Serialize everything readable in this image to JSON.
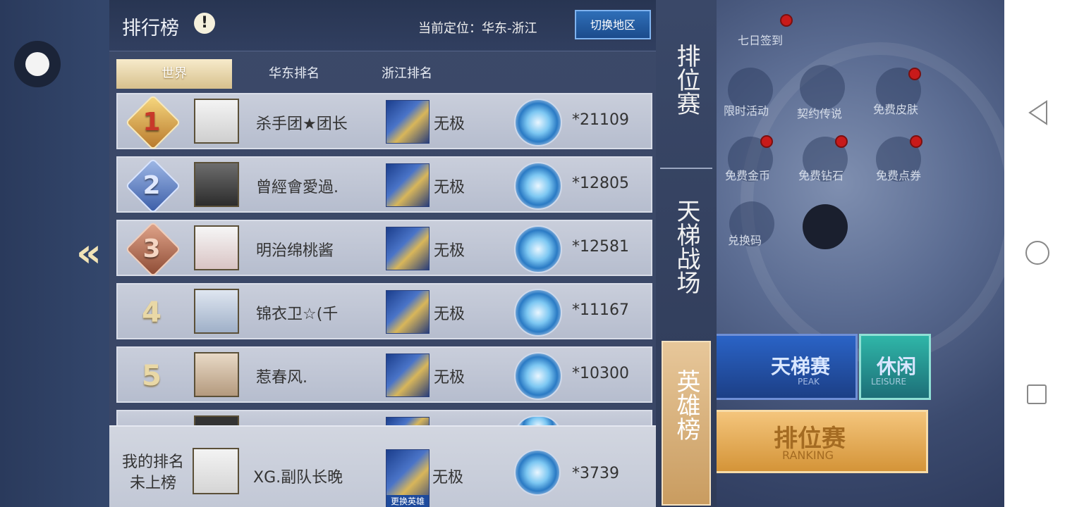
{
  "header": {
    "title": "排行榜",
    "info_symbol": "!",
    "location": "当前定位：华东-浙江",
    "switch_region": "切换地区"
  },
  "tabs": [
    {
      "label": "世界",
      "active": true
    },
    {
      "label": "华东排名",
      "active": false
    },
    {
      "label": "浙江排名",
      "active": false
    }
  ],
  "rows": [
    {
      "rank": "1",
      "name": "杀手团★团长",
      "hero": "无极",
      "score": "*21109"
    },
    {
      "rank": "2",
      "name": "曾經會愛過.",
      "hero": "无极",
      "score": "*12805"
    },
    {
      "rank": "3",
      "name": "明治绵桃酱",
      "hero": "无极",
      "score": "*12581"
    },
    {
      "rank": "4",
      "name": "锦衣卫☆(千",
      "hero": "无极",
      "score": "*11167"
    },
    {
      "rank": "5",
      "name": "惹春风.",
      "hero": "无极",
      "score": "*10300"
    }
  ],
  "my_rank": {
    "label_line1": "我的排名",
    "label_line2": "未上榜",
    "name": "XG.副队长晚",
    "hero": "无极",
    "change_hero": "更换英雄",
    "score": "*3739"
  },
  "side_tabs": [
    {
      "label": "排位赛",
      "active": false
    },
    {
      "label": "天梯战场",
      "active": false
    },
    {
      "label": "英雄榜",
      "active": true
    }
  ],
  "background": {
    "top_icons": [
      "七日签到"
    ],
    "activities": [
      "限时活动",
      "契约传说",
      "免费皮肤",
      "免费金币",
      "免费钻石",
      "免费点券",
      "兑换码"
    ],
    "buttons": {
      "ladder": {
        "label": "天梯赛",
        "sub": "PEAK"
      },
      "leisure": {
        "label": "休闲",
        "sub": "LEISURE"
      },
      "ranking": {
        "label": "排位赛",
        "sub": "RANKING"
      }
    }
  },
  "nav_bar": {
    "back": "back-icon",
    "home": "home-icon",
    "recent": "recent-apps-icon"
  }
}
